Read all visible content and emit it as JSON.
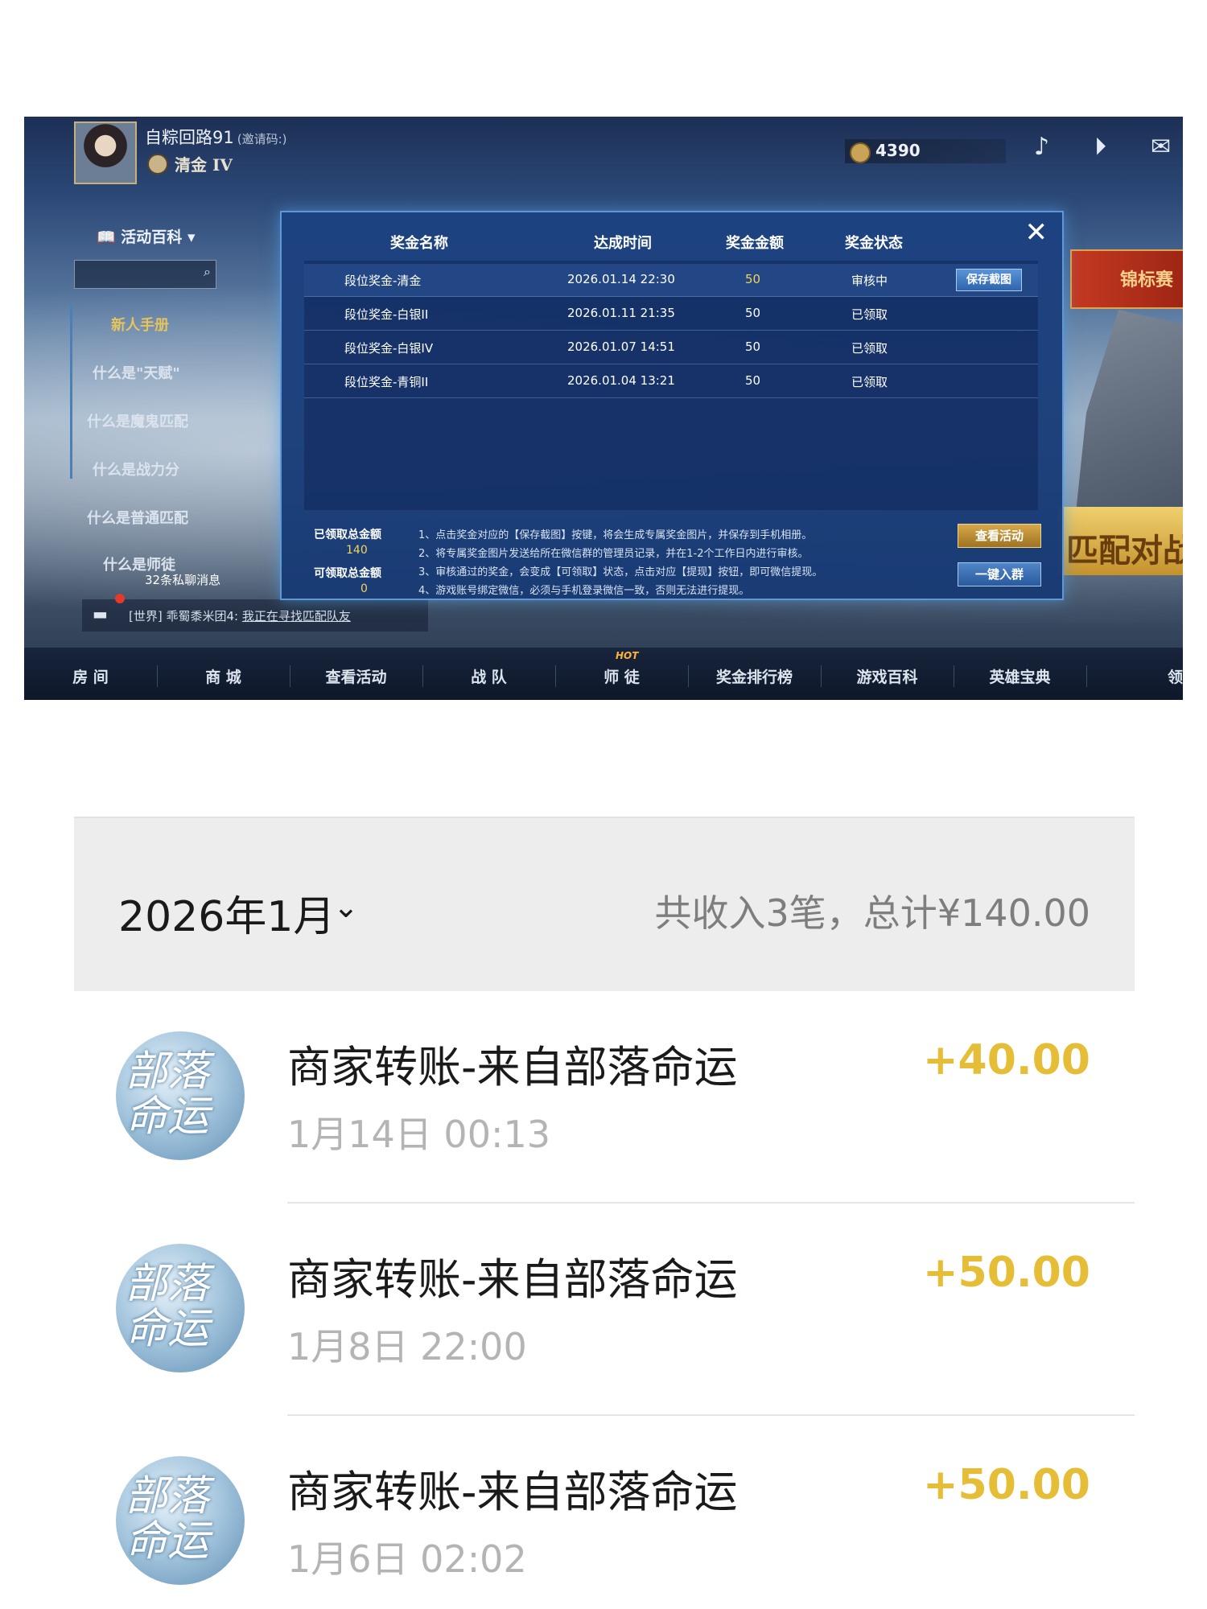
{
  "game": {
    "username": "自粽回路91",
    "invite_label": "(邀请码:)",
    "rank": "清金 IV",
    "coins": "4390",
    "sidebar": {
      "title": "活动百科",
      "items": [
        "新人手册",
        "什么是\"天赋\"",
        "什么是魔鬼匹配",
        "什么是战力分",
        "什么是普通匹配",
        "什么是师徒"
      ]
    },
    "pm_count": "32条私聊消息",
    "chat": {
      "prefix": "[世界] 乖蜀黍米团4:",
      "message": "我正在寻找匹配队友"
    },
    "right_banner": "锦标赛",
    "match_banner": "匹配对战",
    "dialog": {
      "headers": [
        "奖金名称",
        "达成时间",
        "奖金金额",
        "奖金状态"
      ],
      "rows": [
        {
          "name": "段位奖金-清金",
          "time": "2026.01.14 22:30",
          "amount": "50",
          "status": "审核中",
          "button": "保存截图"
        },
        {
          "name": "段位奖金-白银II",
          "time": "2026.01.11 21:35",
          "amount": "50",
          "status": "已领取"
        },
        {
          "name": "段位奖金-白银IV",
          "time": "2026.01.07 14:51",
          "amount": "50",
          "status": "已领取"
        },
        {
          "name": "段位奖金-青铜II",
          "time": "2026.01.04 13:21",
          "amount": "50",
          "status": "已领取"
        }
      ],
      "claimed_label": "已领取总金额",
      "claimed_value": "140",
      "claimable_label": "可领取总金额",
      "claimable_value": "0",
      "notes": [
        "1、点击奖金对应的【保存截图】按键，将会生成专属奖金图片，并保存到手机相册。",
        "2、将专属奖金图片发送给所在微信群的管理员记录，并在1-2个工作日内进行审核。",
        "3、审核通过的奖金，会变成【可领取】状态，点击对应【提现】按钮，即可微信提现。",
        "4、游戏账号绑定微信，必须与手机登录微信一致，否则无法进行提现。"
      ],
      "btn_view": "查看活动",
      "btn_group": "一键入群"
    },
    "nav": [
      "房 间",
      "商 城",
      "查看活动",
      "战 队",
      "师 徒",
      "奖金排行榜",
      "游戏百科",
      "英雄宝典",
      "领"
    ],
    "hot_label": "HOT"
  },
  "wallet": {
    "month": "2026年1月",
    "summary": "共收入3笔，总计¥140.00",
    "logo_text": "部落命运",
    "items": [
      {
        "title": "商家转账-来自部落命运",
        "time": "1月14日 00:13",
        "amount": "+40.00"
      },
      {
        "title": "商家转账-来自部落命运",
        "time": "1月8日 22:00",
        "amount": "+50.00"
      },
      {
        "title": "商家转账-来自部落命运",
        "time": "1月6日 02:02",
        "amount": "+50.00"
      }
    ],
    "amount_color": "#e6bd36"
  }
}
